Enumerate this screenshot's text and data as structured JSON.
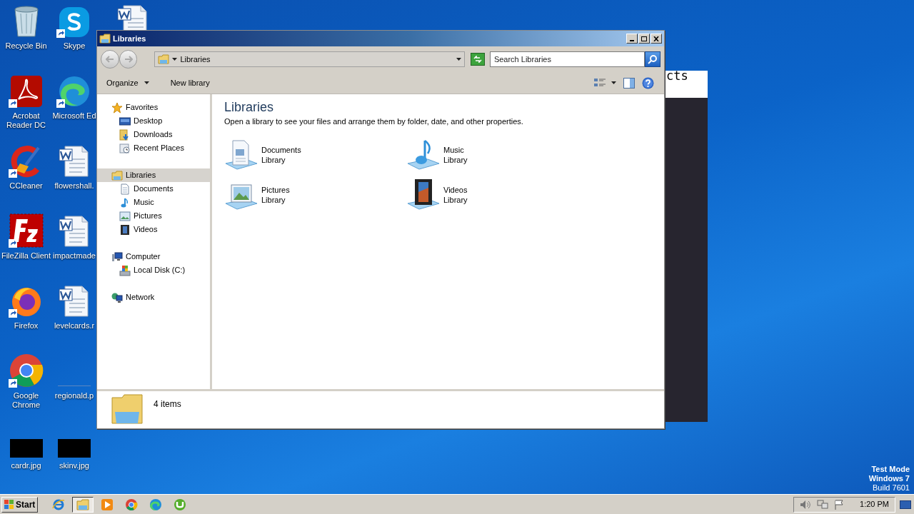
{
  "desktop": {
    "columns": [
      [
        {
          "label": "Recycle Bin",
          "kind": "recycle",
          "shortcut": false
        },
        {
          "label": "Acrobat Reader DC",
          "kind": "acrobat",
          "shortcut": true
        },
        {
          "label": "CCleaner",
          "kind": "ccleaner",
          "shortcut": true
        },
        {
          "label": "FileZilla Client",
          "kind": "filezilla",
          "shortcut": true
        },
        {
          "label": "Firefox",
          "kind": "firefox",
          "shortcut": true
        },
        {
          "label": "Google Chrome",
          "kind": "chrome",
          "shortcut": true
        },
        {
          "label": "cardr.jpg",
          "kind": "image",
          "shortcut": false
        }
      ],
      [
        {
          "label": "Skype",
          "kind": "skype",
          "shortcut": true
        },
        {
          "label": "Microsoft Ed",
          "kind": "edge",
          "shortcut": true
        },
        {
          "label": "flowershall.",
          "kind": "word",
          "shortcut": false
        },
        {
          "label": "impactmade",
          "kind": "word",
          "shortcut": false
        },
        {
          "label": "levelcards.r",
          "kind": "word",
          "shortcut": false
        },
        {
          "label": "regionald.p",
          "kind": "blank",
          "shortcut": false
        },
        {
          "label": "skinv.jpg",
          "kind": "image",
          "shortcut": false
        }
      ]
    ],
    "partial_icon": {
      "kind": "word"
    },
    "back_window": {
      "text": "cts"
    },
    "edition": [
      "Test Mode",
      "Windows 7",
      "Build 7601"
    ]
  },
  "window": {
    "title": "Libraries",
    "address": {
      "path": "Libraries"
    },
    "search": {
      "placeholder": "Search Libraries"
    },
    "toolbar": [
      {
        "label": "Organize",
        "dropdown": true
      },
      {
        "label": "New library",
        "dropdown": false
      }
    ],
    "sidebar": [
      {
        "label": "Favorites",
        "kind": "star",
        "selected": false,
        "children": [
          {
            "label": "Desktop",
            "kind": "desktop",
            "selected": false
          },
          {
            "label": "Downloads",
            "kind": "downloads",
            "selected": false
          },
          {
            "label": "Recent Places",
            "kind": "recent",
            "selected": false
          }
        ]
      },
      {
        "label": "Libraries",
        "kind": "library",
        "selected": true,
        "children": [
          {
            "label": "Documents",
            "kind": "documents",
            "selected": false
          },
          {
            "label": "Music",
            "kind": "music",
            "selected": false
          },
          {
            "label": "Pictures",
            "kind": "pictures",
            "selected": false
          },
          {
            "label": "Videos",
            "kind": "videos",
            "selected": false
          }
        ]
      },
      {
        "label": "Computer",
        "kind": "computer",
        "selected": false,
        "children": [
          {
            "label": "Local Disk (C:)",
            "kind": "disk",
            "selected": false
          }
        ]
      },
      {
        "label": "Network",
        "kind": "network",
        "selected": false
      }
    ],
    "content": {
      "title": "Libraries",
      "description": "Open a library to see your files and arrange them by folder, date, and other properties.",
      "items": [
        {
          "name": "Documents",
          "sub": "Library",
          "kind": "documents"
        },
        {
          "name": "Music",
          "sub": "Library",
          "kind": "music"
        },
        {
          "name": "Pictures",
          "sub": "Library",
          "kind": "pictures"
        },
        {
          "name": "Videos",
          "sub": "Library",
          "kind": "videos"
        }
      ]
    },
    "details": {
      "count": "4 items"
    }
  },
  "taskbar": {
    "start": "Start",
    "apps": [
      {
        "kind": "ie",
        "active": false
      },
      {
        "kind": "explorer",
        "active": true
      },
      {
        "kind": "media",
        "active": false
      },
      {
        "kind": "chrome",
        "active": false
      },
      {
        "kind": "edge",
        "active": false
      },
      {
        "kind": "utorrent",
        "active": false
      }
    ],
    "clock": "1:20 PM"
  }
}
